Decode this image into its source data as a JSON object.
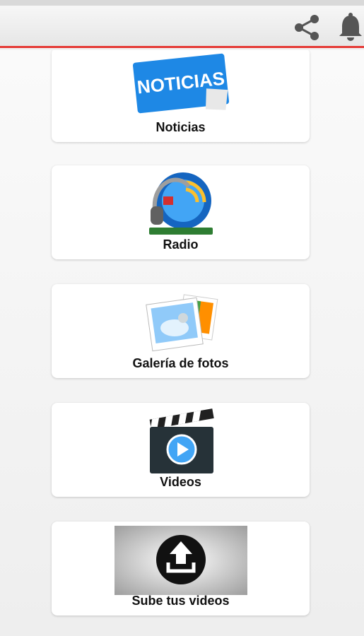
{
  "toolbar": {
    "share_icon": "share-icon",
    "bell_icon": "bell-icon",
    "accent_color": "#e53935"
  },
  "menu": {
    "items": [
      {
        "label": "Noticias",
        "icon": "noticias-sticker-icon",
        "icon_text": "NOTICIAS"
      },
      {
        "label": "Radio",
        "icon": "radio-headphones-icon"
      },
      {
        "label": "Galería de fotos",
        "icon": "photo-gallery-icon"
      },
      {
        "label": "Videos",
        "icon": "clapperboard-play-icon"
      },
      {
        "label": "Sube tus videos",
        "icon": "upload-icon"
      }
    ]
  }
}
